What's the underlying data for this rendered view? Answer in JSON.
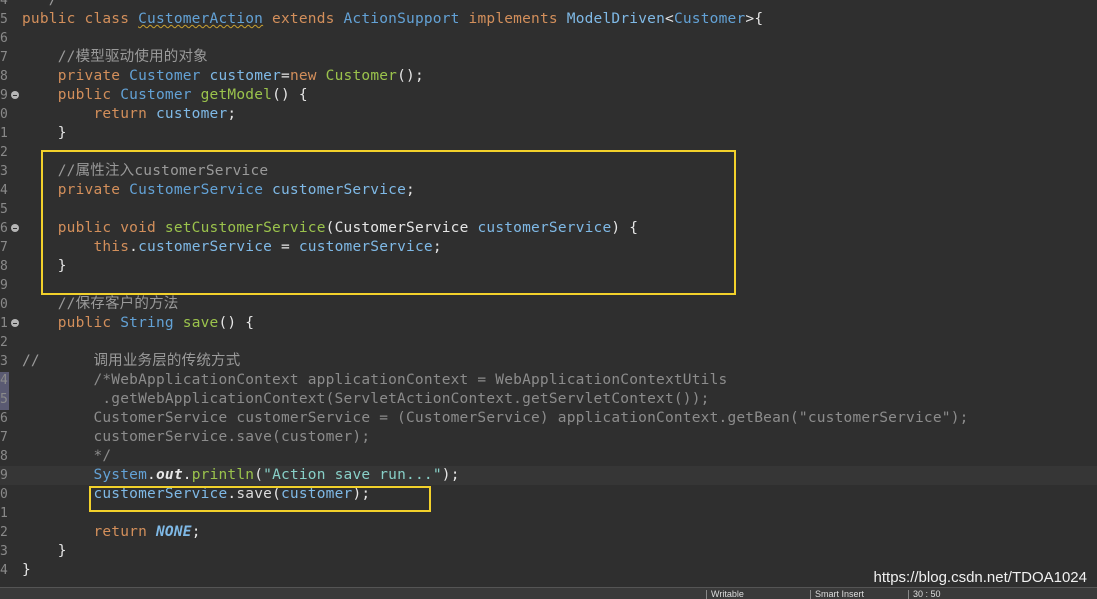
{
  "editor": {
    "lines": [
      {
        "num": "4",
        "fold": false,
        "current": false,
        "tokens": [
          {
            "t": "  */",
            "c": "t-comment"
          }
        ]
      },
      {
        "num": "5",
        "fold": false,
        "current": false,
        "tokens": [
          {
            "t": "public class ",
            "c": "t-keyword"
          },
          {
            "t": "CustomerAction",
            "c": "t-type squig"
          },
          {
            "t": " extends ",
            "c": "t-keyword"
          },
          {
            "t": "ActionSupport",
            "c": "t-type"
          },
          {
            "t": " implements ",
            "c": "t-keyword"
          },
          {
            "t": "ModelDriven",
            "c": "t-field"
          },
          {
            "t": "<",
            "c": "t-default"
          },
          {
            "t": "Customer",
            "c": "t-type"
          },
          {
            "t": ">{",
            "c": "t-default"
          }
        ]
      },
      {
        "num": "6",
        "fold": false,
        "current": false,
        "tokens": []
      },
      {
        "num": "7",
        "fold": false,
        "current": false,
        "tokens": [
          {
            "t": "    //模型驱动使用的对象",
            "c": "t-comment"
          }
        ]
      },
      {
        "num": "8",
        "fold": false,
        "current": false,
        "tokens": [
          {
            "t": "    private ",
            "c": "t-keyword"
          },
          {
            "t": "Customer",
            "c": "t-type"
          },
          {
            "t": " customer",
            "c": "t-field"
          },
          {
            "t": "=",
            "c": "t-default"
          },
          {
            "t": "new ",
            "c": "t-keyword"
          },
          {
            "t": "Customer",
            "c": "t-method"
          },
          {
            "t": "();",
            "c": "t-default"
          }
        ]
      },
      {
        "num": "9",
        "fold": true,
        "current": false,
        "tokens": [
          {
            "t": "    public ",
            "c": "t-keyword"
          },
          {
            "t": "Customer",
            "c": "t-type"
          },
          {
            "t": " getModel",
            "c": "t-method"
          },
          {
            "t": "() {",
            "c": "t-default"
          }
        ]
      },
      {
        "num": "0",
        "fold": false,
        "current": false,
        "tokens": [
          {
            "t": "        return ",
            "c": "t-keyword"
          },
          {
            "t": "customer",
            "c": "t-field"
          },
          {
            "t": ";",
            "c": "t-default"
          }
        ]
      },
      {
        "num": "1",
        "fold": false,
        "current": false,
        "tokens": [
          {
            "t": "    }",
            "c": "t-default"
          }
        ]
      },
      {
        "num": "2",
        "fold": false,
        "current": false,
        "tokens": []
      },
      {
        "num": "3",
        "fold": false,
        "current": false,
        "tokens": [
          {
            "t": "    //属性注入customerService",
            "c": "t-comment"
          }
        ]
      },
      {
        "num": "4",
        "fold": false,
        "current": false,
        "tokens": [
          {
            "t": "    private ",
            "c": "t-keyword"
          },
          {
            "t": "CustomerService",
            "c": "t-type"
          },
          {
            "t": " customerService",
            "c": "t-field"
          },
          {
            "t": ";",
            "c": "t-default"
          }
        ]
      },
      {
        "num": "5",
        "fold": false,
        "current": false,
        "tokens": []
      },
      {
        "num": "6",
        "fold": true,
        "current": false,
        "tokens": [
          {
            "t": "    public void ",
            "c": "t-keyword"
          },
          {
            "t": "setCustomerService",
            "c": "t-method"
          },
          {
            "t": "(",
            "c": "t-default"
          },
          {
            "t": "CustomerService",
            "c": "t-default"
          },
          {
            "t": " customerService",
            "c": "t-field"
          },
          {
            "t": ") {",
            "c": "t-default"
          }
        ]
      },
      {
        "num": "7",
        "fold": false,
        "current": false,
        "tokens": [
          {
            "t": "        this",
            "c": "t-keyword"
          },
          {
            "t": ".",
            "c": "t-default"
          },
          {
            "t": "customerService",
            "c": "t-field"
          },
          {
            "t": " = ",
            "c": "t-default"
          },
          {
            "t": "customerService",
            "c": "t-field"
          },
          {
            "t": ";",
            "c": "t-default"
          }
        ]
      },
      {
        "num": "8",
        "fold": false,
        "current": false,
        "tokens": [
          {
            "t": "    }",
            "c": "t-default"
          }
        ]
      },
      {
        "num": "9",
        "fold": false,
        "current": false,
        "tokens": []
      },
      {
        "num": "0",
        "fold": false,
        "current": false,
        "tokens": [
          {
            "t": "    //保存客户的方法",
            "c": "t-comment"
          }
        ]
      },
      {
        "num": "1",
        "fold": true,
        "current": false,
        "tokens": [
          {
            "t": "    public ",
            "c": "t-keyword"
          },
          {
            "t": "String",
            "c": "t-type"
          },
          {
            "t": " save",
            "c": "t-method"
          },
          {
            "t": "() {",
            "c": "t-default"
          }
        ]
      },
      {
        "num": "2",
        "fold": false,
        "current": false,
        "tokens": []
      },
      {
        "num": "3",
        "fold": false,
        "current": false,
        "tokens": [
          {
            "t": "//      调用业务层的传统方式",
            "c": "t-comment"
          }
        ]
      },
      {
        "num": "4",
        "fold": false,
        "current": false,
        "tokens": [
          {
            "t": "        /*WebApplicationContext applicationContext = WebApplicationContextUtils",
            "c": "t-blockcomment"
          }
        ]
      },
      {
        "num": "5",
        "fold": false,
        "current": false,
        "tokens": [
          {
            "t": "         .getWebApplicationContext(ServletActionContext.getServletContext());",
            "c": "t-blockcomment"
          }
        ]
      },
      {
        "num": "6",
        "fold": false,
        "current": false,
        "tokens": [
          {
            "t": "        CustomerService customerService = (CustomerService) applicationContext.getBean(\"customerService\");",
            "c": "t-blockcomment"
          }
        ]
      },
      {
        "num": "7",
        "fold": false,
        "current": false,
        "tokens": [
          {
            "t": "        customerService.save(customer);",
            "c": "t-blockcomment"
          }
        ]
      },
      {
        "num": "8",
        "fold": false,
        "current": false,
        "tokens": [
          {
            "t": "        */",
            "c": "t-blockcomment"
          }
        ]
      },
      {
        "num": "9",
        "fold": false,
        "current": true,
        "tokens": [
          {
            "t": "        System",
            "c": "t-type"
          },
          {
            "t": ".",
            "c": "t-default"
          },
          {
            "t": "out",
            "c": "t-static"
          },
          {
            "t": ".",
            "c": "t-default"
          },
          {
            "t": "println",
            "c": "t-method"
          },
          {
            "t": "(",
            "c": "t-default"
          },
          {
            "t": "\"Action save run...\"",
            "c": "t-string"
          },
          {
            "t": ");",
            "c": "t-default"
          }
        ]
      },
      {
        "num": "0",
        "fold": false,
        "current": false,
        "tokens": [
          {
            "t": "        customerService",
            "c": "t-field"
          },
          {
            "t": ".",
            "c": "t-default"
          },
          {
            "t": "save",
            "c": "t-plain"
          },
          {
            "t": "(",
            "c": "t-default"
          },
          {
            "t": "customer",
            "c": "t-field"
          },
          {
            "t": ");",
            "c": "t-default"
          }
        ]
      },
      {
        "num": "1",
        "fold": false,
        "current": false,
        "tokens": []
      },
      {
        "num": "2",
        "fold": false,
        "current": false,
        "tokens": [
          {
            "t": "        return ",
            "c": "t-keyword"
          },
          {
            "t": "NONE",
            "c": "t-const"
          },
          {
            "t": ";",
            "c": "t-default"
          }
        ]
      },
      {
        "num": "3",
        "fold": false,
        "current": false,
        "tokens": [
          {
            "t": "    }",
            "c": "t-default"
          }
        ]
      },
      {
        "num": "4",
        "fold": false,
        "current": false,
        "tokens": [
          {
            "t": "}",
            "c": "t-default"
          }
        ]
      }
    ]
  },
  "status": {
    "segments": [
      "Writable",
      "Smart Insert",
      "30 : 50"
    ]
  },
  "watermark": "https://blog.csdn.net/TDOA1024",
  "colors": {
    "highlight_box": "#f2d12b",
    "background": "#2f2f2f"
  }
}
